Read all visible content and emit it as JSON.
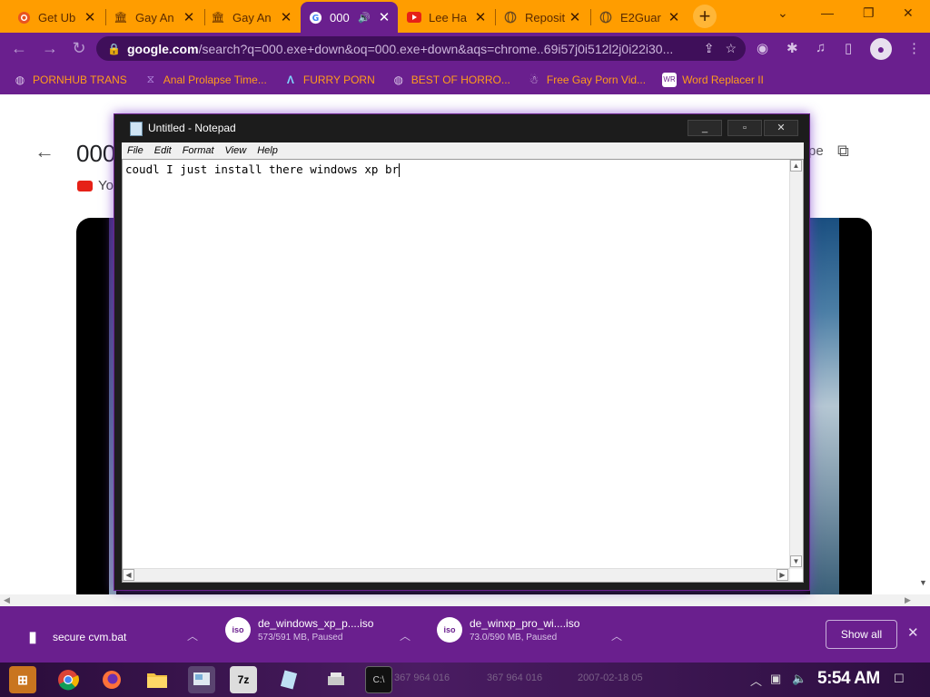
{
  "browser": {
    "tabs": [
      {
        "title": "Get Ub",
        "icon": "ubuntu-icon",
        "active": false
      },
      {
        "title": "Gay An",
        "icon": "archive-icon",
        "active": false
      },
      {
        "title": "Gay An",
        "icon": "archive-icon",
        "active": false
      },
      {
        "title": "000",
        "icon": "google-icon",
        "active": true,
        "audio": true
      },
      {
        "title": "Lee Ha",
        "icon": "youtube-icon",
        "active": false
      },
      {
        "title": "Reposit",
        "icon": "globe-icon",
        "active": false
      },
      {
        "title": "E2Guar",
        "icon": "globe-icon",
        "active": false
      }
    ],
    "omnibox": {
      "domain": "google.com",
      "path": "/search?q=000.exe+down&oq=000.exe+down&aqs=chrome..69i57j0i512l2j0i22i30..."
    },
    "bookmarks": [
      {
        "label": "PORNHUB TRANS",
        "icon": "globe-icon"
      },
      {
        "label": "Anal Prolapse Time...",
        "icon": "bookmark-icon"
      },
      {
        "label": "FURRY PORN",
        "icon": "lambda-icon"
      },
      {
        "label": "BEST OF HORRO...",
        "icon": "globe-icon"
      },
      {
        "label": "Free Gay Porn Vid...",
        "icon": "ghost-icon"
      },
      {
        "label": "Word Replacer II",
        "icon": "wr-icon"
      }
    ]
  },
  "page": {
    "title": "000",
    "source": "Yo",
    "share": "pe"
  },
  "notepad": {
    "title": "Untitled - Notepad",
    "menu": [
      "File",
      "Edit",
      "Format",
      "View",
      "Help"
    ],
    "content": "coudl I just install there windows xp br"
  },
  "downloads": {
    "items": [
      {
        "name": "secure cvm.bat",
        "status": "",
        "icon": "file-icon"
      },
      {
        "name": "de_windows_xp_p....iso",
        "status": "573/591 MB, Paused",
        "icon": "iso-icon"
      },
      {
        "name": "de_winxp_pro_wi....iso",
        "status": "73.0/590 MB, Paused",
        "icon": "iso-icon"
      }
    ],
    "show_all": "Show all"
  },
  "taskbar": {
    "clock": "5:54 AM",
    "apps": [
      "start-button",
      "chrome-icon",
      "firefox-icon",
      "folder-icon",
      "paint-icon",
      "7zip-icon",
      "notepad-icon",
      "media-icon",
      "cmd-icon"
    ],
    "ghost_text": [
      "367 964 016",
      "367 964 016",
      "2007-02-18 05"
    ]
  }
}
